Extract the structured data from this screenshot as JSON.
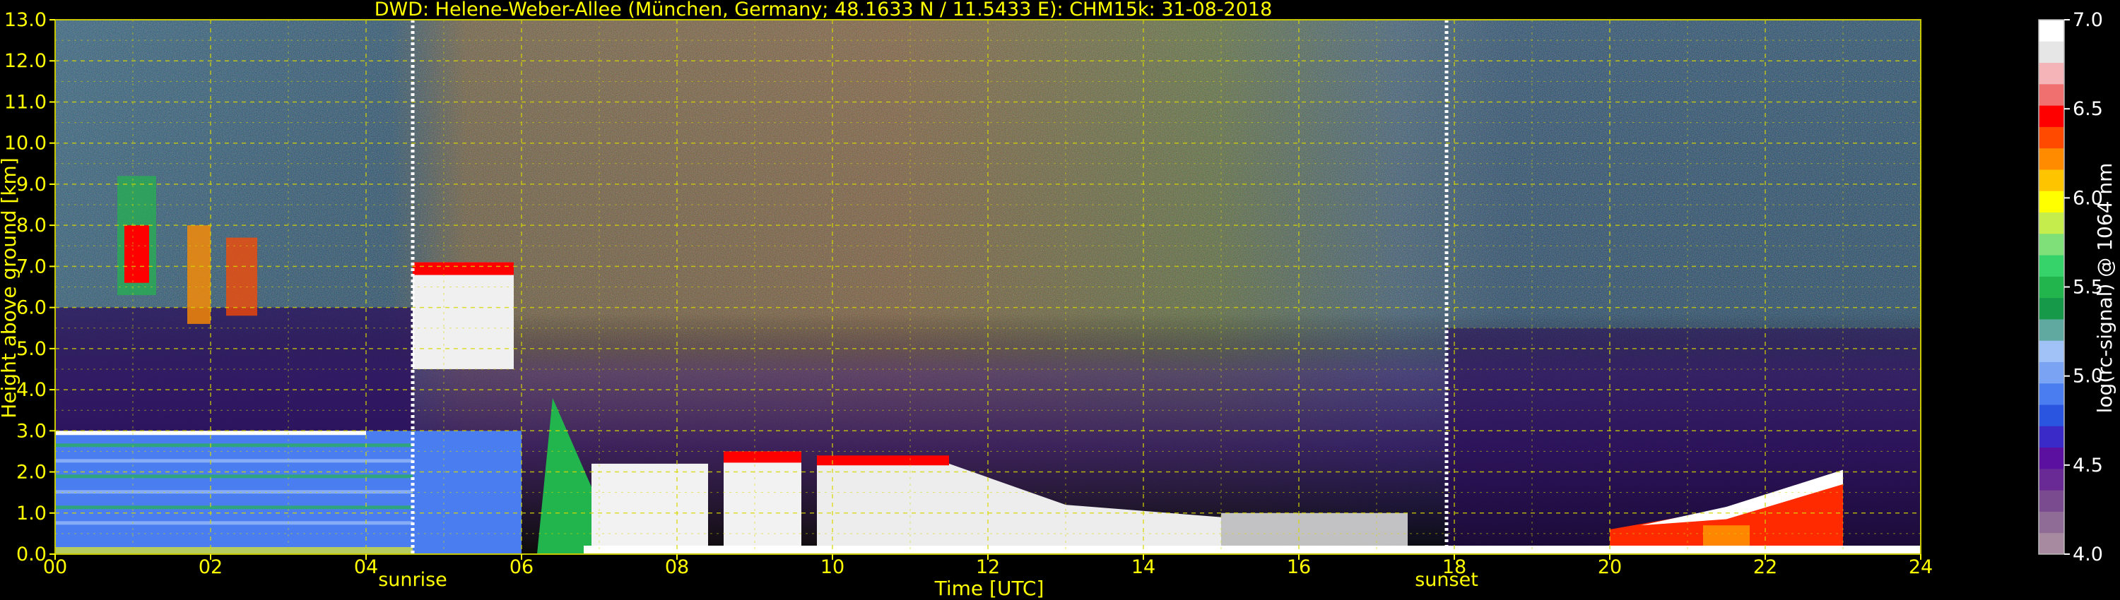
{
  "chart_data": {
    "type": "heatmap",
    "title": "DWD: Helene-Weber-Allee (München, Germany; 48.1633 N / 11.5433 E):    CHM15k: 31-08-2018",
    "xlabel": "Time [UTC]",
    "ylabel": "Height above ground [km]",
    "xlim": [
      0,
      24
    ],
    "ylim": [
      0,
      13
    ],
    "x_ticks": [
      "00",
      "02",
      "04",
      "06",
      "08",
      "10",
      "12",
      "14",
      "16",
      "18",
      "20",
      "22",
      "24"
    ],
    "y_ticks": [
      "0.0",
      "1.0",
      "2.0",
      "3.0",
      "4.0",
      "5.0",
      "6.0",
      "7.0",
      "8.0",
      "9.0",
      "10.0",
      "11.0",
      "12.0",
      "13.0"
    ],
    "grid": true,
    "colorbar": {
      "label": "log(rc-signal) @ 1064 nm",
      "range": [
        4.0,
        7.0
      ],
      "ticks": [
        "4.0",
        "4.5",
        "5.0",
        "5.5",
        "6.0",
        "6.5",
        "7.0"
      ],
      "colors": [
        "#a78aa0",
        "#8e6c95",
        "#7a4b8f",
        "#6a2a96",
        "#5c10a0",
        "#3a2bc8",
        "#2a55e0",
        "#4a7ef0",
        "#7aa3f4",
        "#a0c2f6",
        "#5fa9a0",
        "#169a4a",
        "#23b54d",
        "#36d36b",
        "#7fe07a",
        "#c5ee4c",
        "#ffff00",
        "#ffc400",
        "#ff8c00",
        "#ff4a00",
        "#ff0000",
        "#f07070",
        "#f4b4b8",
        "#e6e6e6",
        "#ffffff"
      ]
    },
    "annotations": [
      {
        "label": "sunrise",
        "time": 4.6
      },
      {
        "label": "sunset",
        "time": 17.9
      }
    ],
    "features": [
      {
        "kind": "cirrus",
        "t0": 0.8,
        "t1": 1.3,
        "h0": 6.3,
        "h1": 9.2
      },
      {
        "kind": "cloud",
        "t0": 4.6,
        "t1": 5.9,
        "h0": 4.5,
        "h1": 7.1
      },
      {
        "kind": "boundary-layer-top",
        "t0": 0.0,
        "t1": 4.6,
        "h0": 2.1,
        "h1": 3.0
      },
      {
        "kind": "convective-clouds",
        "t0": 6.3,
        "t1": 15.0,
        "h0": 0.2,
        "h1": 2.5
      },
      {
        "kind": "evening-clouds",
        "t0": 20.0,
        "t1": 23.0,
        "h0": 0.2,
        "h1": 2.0
      }
    ]
  }
}
